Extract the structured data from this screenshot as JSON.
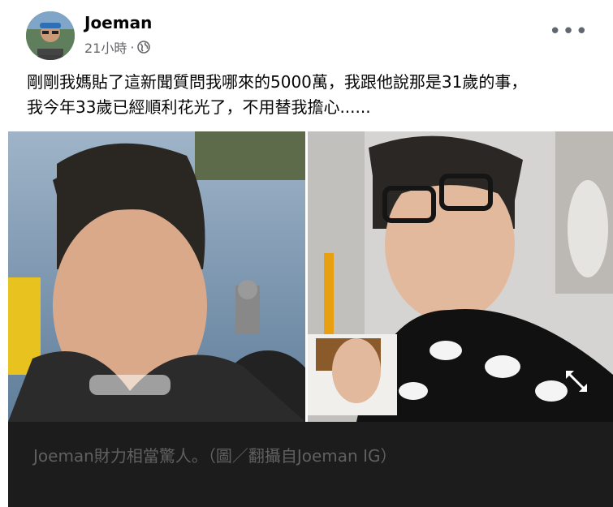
{
  "author": {
    "name": "Joeman",
    "time": "21小時",
    "separator": "·",
    "privacy_icon": "globe-icon"
  },
  "more_icon": "more-options-icon",
  "post_text": "剛剛我媽貼了這新聞質問我哪來的5000萬，我跟他說那是31歲的事，\n我今年33歲已經順利花光了，不用替我擔心......",
  "photos": {
    "left_alt": "photo-left",
    "right_alt": "photo-right",
    "expand_icon": "expand-icon"
  },
  "caption": "Joeman財力相當驚人。（圖／翻攝自Joeman IG）",
  "colors": {
    "text": "#050505",
    "meta": "#65676b",
    "caption_bg": "#1c1c1c",
    "caption_text": "#606060"
  }
}
